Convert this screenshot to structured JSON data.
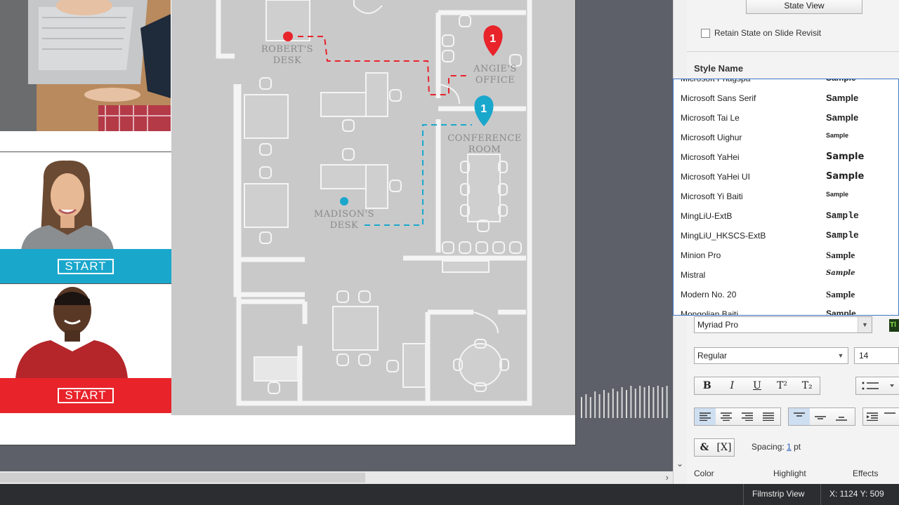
{
  "floorplan": {
    "labels": {
      "robert": [
        "ROBERT'S",
        "DESK"
      ],
      "angie": [
        "ANGIE'S",
        "OFFICE"
      ],
      "conference": [
        "CONFERENCE",
        "ROOM"
      ],
      "madison": [
        "MADISON'S",
        "DESK"
      ]
    },
    "pins": {
      "angie": "1",
      "conference": "1"
    },
    "colors": {
      "red": "#e8232a",
      "blue": "#1aa7cc"
    }
  },
  "cards": {
    "madison": {
      "start_label": "START",
      "color": "#1aa7cc"
    },
    "robert": {
      "start_label": "START",
      "color": "#e8232a"
    }
  },
  "panel": {
    "state_view_label": "State View",
    "retain_state_label": "Retain State on Slide Revisit",
    "style_name_heading": "Style Name",
    "fonts": [
      {
        "name": "Microsoft Phagspa",
        "sample": "Sample"
      },
      {
        "name": "Microsoft Sans Serif",
        "sample": "Sample"
      },
      {
        "name": "Microsoft Tai Le",
        "sample": "Sample"
      },
      {
        "name": "Microsoft Uighur",
        "sample": "Sample"
      },
      {
        "name": "Microsoft YaHei",
        "sample": "Sample"
      },
      {
        "name": "Microsoft YaHei UI",
        "sample": "Sample"
      },
      {
        "name": "Microsoft Yi Baiti",
        "sample": "Sample"
      },
      {
        "name": "MingLiU-ExtB",
        "sample": "Sample"
      },
      {
        "name": "MingLiU_HKSCS-ExtB",
        "sample": "Sample"
      },
      {
        "name": "Minion Pro",
        "sample": "Sample"
      },
      {
        "name": "Mistral",
        "sample": "Sample"
      },
      {
        "name": "Modern No. 20",
        "sample": "Sample"
      },
      {
        "name": "Mongolian Baiti",
        "sample": "Sample"
      }
    ],
    "font_family_value": "Myriad Pro",
    "tl_badge": "Tl",
    "font_style_value": "Regular",
    "font_size_value": "14",
    "format_buttons": {
      "bold": "B",
      "italic": "I",
      "underline": "U",
      "superscript": "T²",
      "subscript": "T₂"
    },
    "insert_buttons": {
      "symbol": "&",
      "variable": "[X]"
    },
    "spacing_label": "Spacing:",
    "spacing_value": "1",
    "spacing_unit": "pt",
    "tabs": {
      "color": "Color",
      "highlight": "Highlight",
      "effects": "Effects"
    }
  },
  "statusbar": {
    "filmstrip_view": "Filmstrip View",
    "coordinates": "X: 1124 Y: 509"
  }
}
